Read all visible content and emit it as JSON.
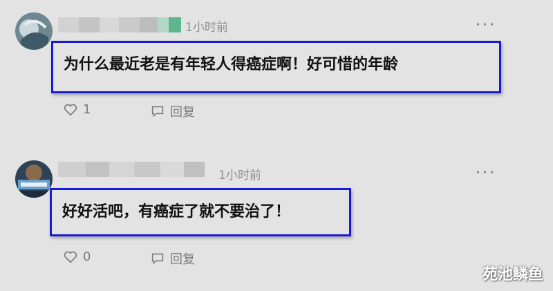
{
  "comments": [
    {
      "time": "1小时前",
      "text": "为什么最近老是有年轻人得癌症啊！好可惜的年龄",
      "like_count": "1",
      "reply_label": "回复",
      "more_label": "···"
    },
    {
      "time": "1小时前",
      "text": "好好活吧，有癌症了就不要治了！",
      "like_count": "0",
      "reply_label": "回复",
      "more_label": "···"
    }
  ],
  "watermark": "苑池鳞鱼",
  "colors": {
    "background": "#e3e3e3",
    "highlight_border": "#1a1ad6",
    "meta_text": "#8e8e8e"
  }
}
